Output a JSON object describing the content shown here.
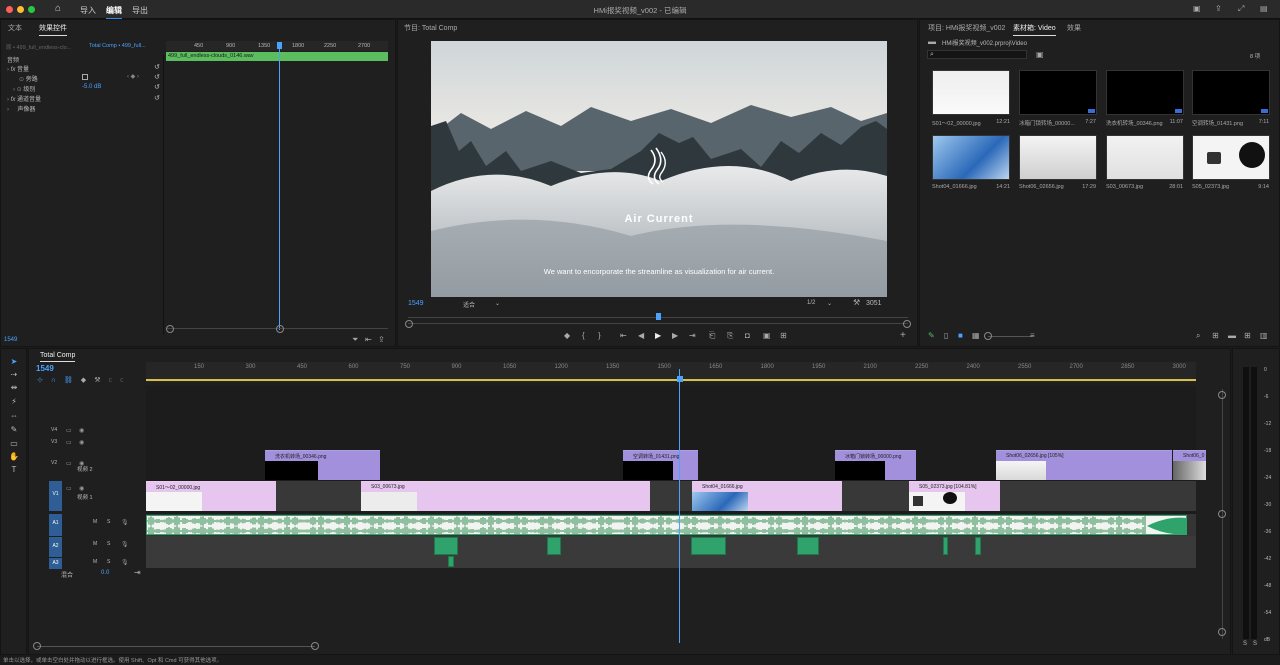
{
  "app": {
    "menu": [
      "导入",
      "编辑",
      "导出"
    ],
    "doc_title": "HMi报奖视频_v002 - 已编辑"
  },
  "colors": {
    "accent": "#2d8ceb",
    "audio_clip": "#2fa36b",
    "v2_clip": "#a290dd",
    "v1_clip": "#e6c6ee",
    "timeline_blue": "#4dc0ff"
  },
  "effect_controls": {
    "tabs": [
      "文本",
      "效果控件"
    ],
    "source": "原 • 499_full_endless-clo...",
    "seq": "Total Comp • 499_full...",
    "ruler": [
      "450",
      "900",
      "1350",
      "1800",
      "2250",
      "2700"
    ],
    "clip_name": "499_full_endless-clouds_0146.wav",
    "section": "音频",
    "rows": [
      {
        "label": "音量",
        "fx": "fx"
      },
      {
        "label": "旁路"
      },
      {
        "label": "级别",
        "value": "-5.0 dB"
      },
      {
        "label": "通道音量",
        "fx": "fx"
      },
      {
        "label": "声像器"
      }
    ],
    "timecode": "1549"
  },
  "program": {
    "tab": "节目: Total Comp",
    "title": "Air Current",
    "subtitle": "We want to encorporate the streamline as visualization for air current.",
    "timecode": "1549",
    "fit": "适合",
    "resolution": "1/2",
    "duration": "3051"
  },
  "project": {
    "tabs": [
      "项目: HMi报奖视频_v002",
      "素材箱: Video",
      "效果"
    ],
    "path": "HMi报奖视频_v002.prproj\\Video",
    "count": "8 项",
    "items": [
      {
        "name": "S01～02_00000.jpg",
        "dur": "12:21"
      },
      {
        "name": "冰箱门锁转场_00000...",
        "dur": "7:27"
      },
      {
        "name": "洗衣机转场_00346.png",
        "dur": "11:07"
      },
      {
        "name": "空调转场_01431.png",
        "dur": "7:11"
      },
      {
        "name": "Shot04_01666.jpg",
        "dur": "14:21"
      },
      {
        "name": "Shot06_02656.jpg",
        "dur": "17:29"
      },
      {
        "name": "S03_00673.jpg",
        "dur": "28:01"
      },
      {
        "name": "S05_02373.jpg",
        "dur": "9:14"
      }
    ]
  },
  "timeline": {
    "tab": "Total Comp",
    "timecode": "1549",
    "ruler": [
      "150",
      "300",
      "450",
      "600",
      "750",
      "900",
      "1050",
      "1200",
      "1350",
      "1500",
      "1650",
      "1800",
      "1950",
      "2100",
      "2250",
      "2400",
      "2550",
      "2700",
      "2850",
      "3000"
    ],
    "tracks": {
      "v4": "V4",
      "v3": "V3",
      "v2": "V2",
      "v2name": "视频 2",
      "v1": "V1",
      "v1name": "视频 1",
      "a1": "A1",
      "a2": "A2",
      "a3": "A3",
      "mix": "混合",
      "mix_val": "0.0",
      "m": "M",
      "s": "S"
    },
    "v2_clips": [
      "洗衣机转场_00346.png",
      "空调转场_01431.png",
      "冰箱门锁转场_00000.png",
      "Shot06_02656.jpg [105%]",
      "Shot06_0"
    ],
    "v1_clips": [
      "S01～02_00000.jpg",
      "S03_00673.jpg",
      "Shot04_01666.jpg",
      "S05_02373.jpg [104.81%]"
    ],
    "meter_scale": [
      "0",
      "-6",
      "-12",
      "-18",
      "-24",
      "-30",
      "-36",
      "-42",
      "-48",
      "-54",
      "dB"
    ]
  },
  "status": "单击以选择，或单击空白处并拖动以进行框选。使用 Shift、Opt 和 Cmd 可获得其他选项。"
}
